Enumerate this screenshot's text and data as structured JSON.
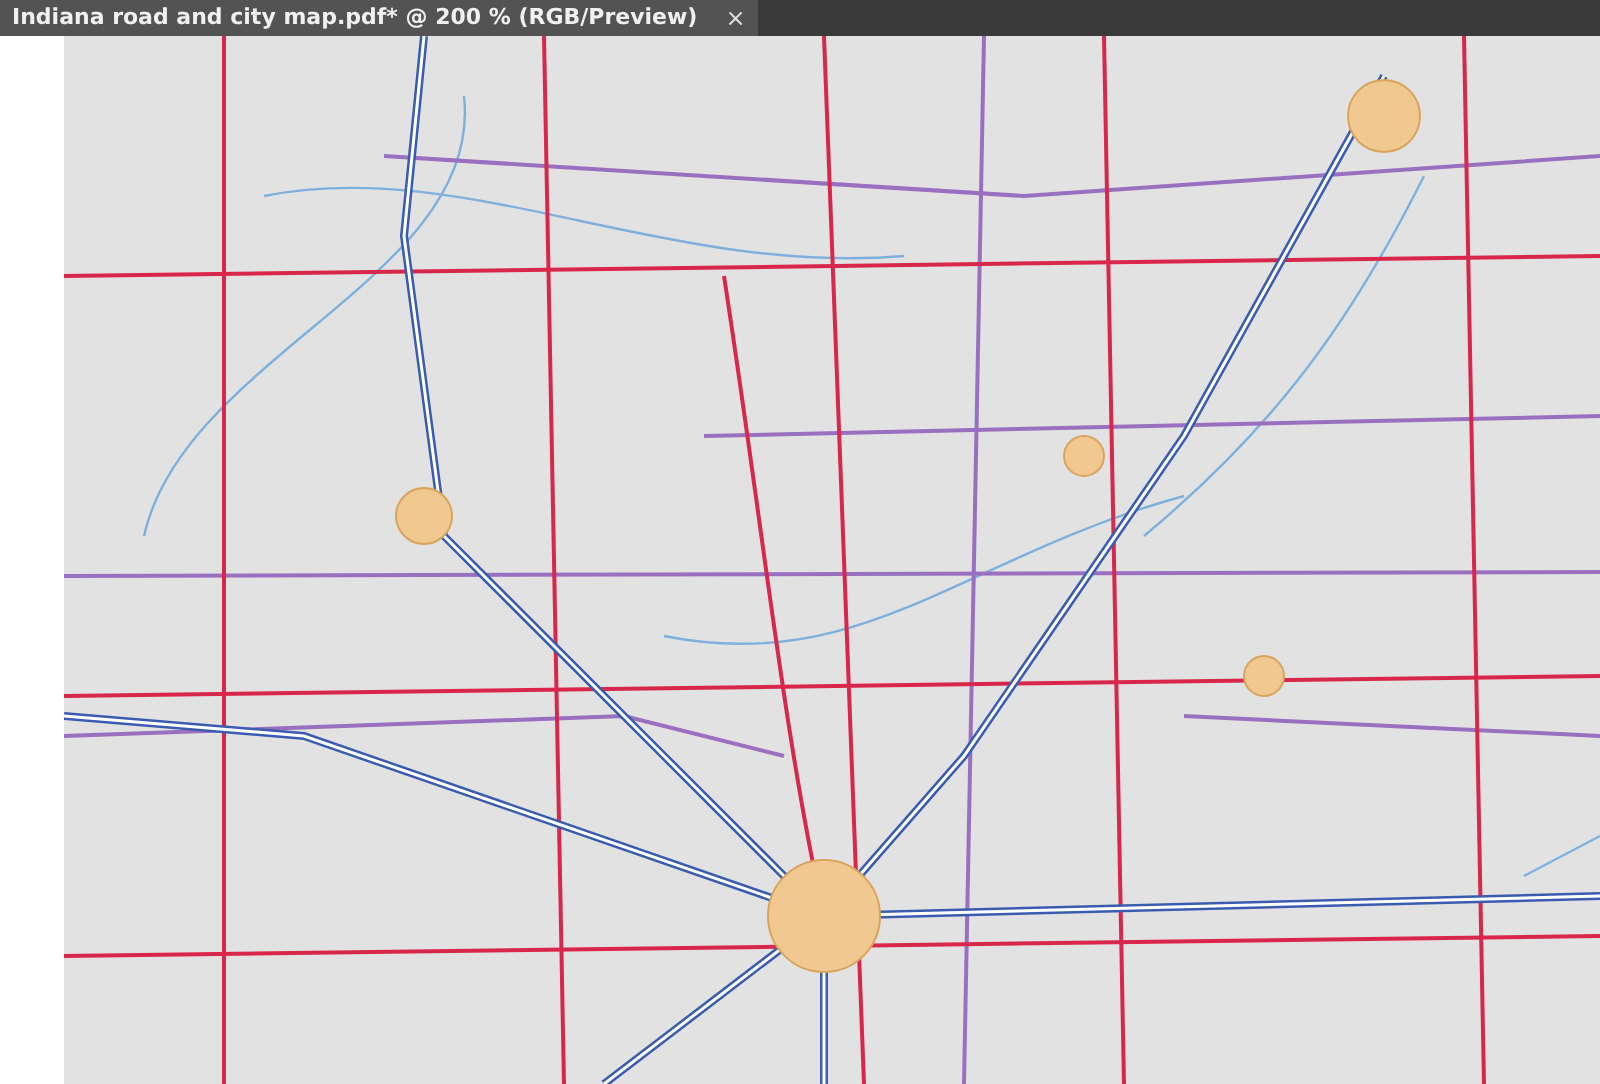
{
  "tabs": [
    {
      "label": "Indiana road and city map.pdf* @ 200 % (RGB/Preview)",
      "close": "×",
      "selected": true
    }
  ]
}
